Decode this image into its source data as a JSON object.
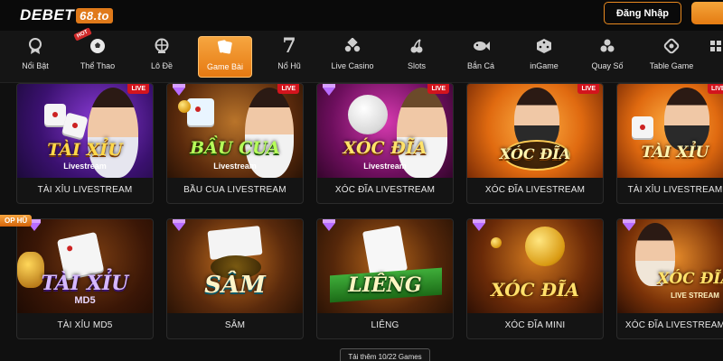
{
  "header": {
    "logo_main": "DEBET",
    "logo_tag": "68.to",
    "login_label": "Đăng Nhập"
  },
  "nav": {
    "hot_badge": "HOT",
    "items": [
      {
        "label": "Nổi Bật",
        "icon": "medal-icon"
      },
      {
        "label": "Thể Thao",
        "icon": "soccer-ball-icon"
      },
      {
        "label": "Lô Đề",
        "icon": "lottery-wheel-icon"
      },
      {
        "label": "Game Bài",
        "icon": "cards-icon"
      },
      {
        "label": "Nổ Hũ",
        "icon": "slot-seven-icon"
      },
      {
        "label": "Live Casino",
        "icon": "chips-icon"
      },
      {
        "label": "Slots",
        "icon": "cherry-icon"
      },
      {
        "label": "Bắn Cá",
        "icon": "fish-icon"
      },
      {
        "label": "inGame",
        "icon": "dice-cube-icon"
      },
      {
        "label": "Quay Số",
        "icon": "lottery-balls-icon"
      },
      {
        "label": "Table Game",
        "icon": "table-chip-icon"
      }
    ]
  },
  "cards": [
    {
      "title": "TÀI XỈU LIVESTREAM",
      "badge": "LIVE",
      "art_text": "TÀI XỈU",
      "art_sub": "Livestream",
      "theme": "purple"
    },
    {
      "title": "BẦU CUA LIVESTREAM",
      "badge": "LIVE",
      "art_text": "BẦU CUA",
      "art_sub": "Livestream",
      "theme": "gold"
    },
    {
      "title": "XÓC ĐĨA LIVESTREAM",
      "badge": "LIVE",
      "art_text": "XÓC ĐĨA",
      "art_sub": "Livestream",
      "theme": "magenta"
    },
    {
      "title": "XÓC ĐĨA LIVESTREAM",
      "badge": "LIVE",
      "art_text": "XÓC ĐĨA",
      "art_sub": "",
      "theme": "orange"
    },
    {
      "title": "TÀI XỈU LIVESTREAM",
      "badge": "LIVE",
      "art_text": "TÀI XỈU",
      "art_sub": "",
      "theme": "orange"
    },
    {
      "title": "TÀI XỈU MD5",
      "badge": "",
      "art_text": "TÀI XỈU",
      "art_sub": "MD5",
      "theme": "brown"
    },
    {
      "title": "SÂM",
      "badge": "",
      "art_text": "SÂM",
      "art_sub": "",
      "theme": "brown"
    },
    {
      "title": "LIÊNG",
      "badge": "",
      "art_text": "LIÊNG",
      "art_sub": "",
      "theme": "brown"
    },
    {
      "title": "XÓC ĐĨA MINI",
      "badge": "",
      "art_text": "XÓC ĐĨA",
      "art_sub": "",
      "theme": "brown"
    },
    {
      "title": "XÓC ĐĨA LIVESTREAM",
      "badge": "",
      "art_text": "XÓC ĐĨA",
      "art_sub": "LIVE STREAM",
      "theme": "brown"
    }
  ],
  "top_hu_badge": "OP HŨ",
  "load_more_label": "Tải thêm 10/22 Games",
  "colors": {
    "accent": "#e8891f",
    "live": "#d3141d",
    "background": "#101010"
  }
}
